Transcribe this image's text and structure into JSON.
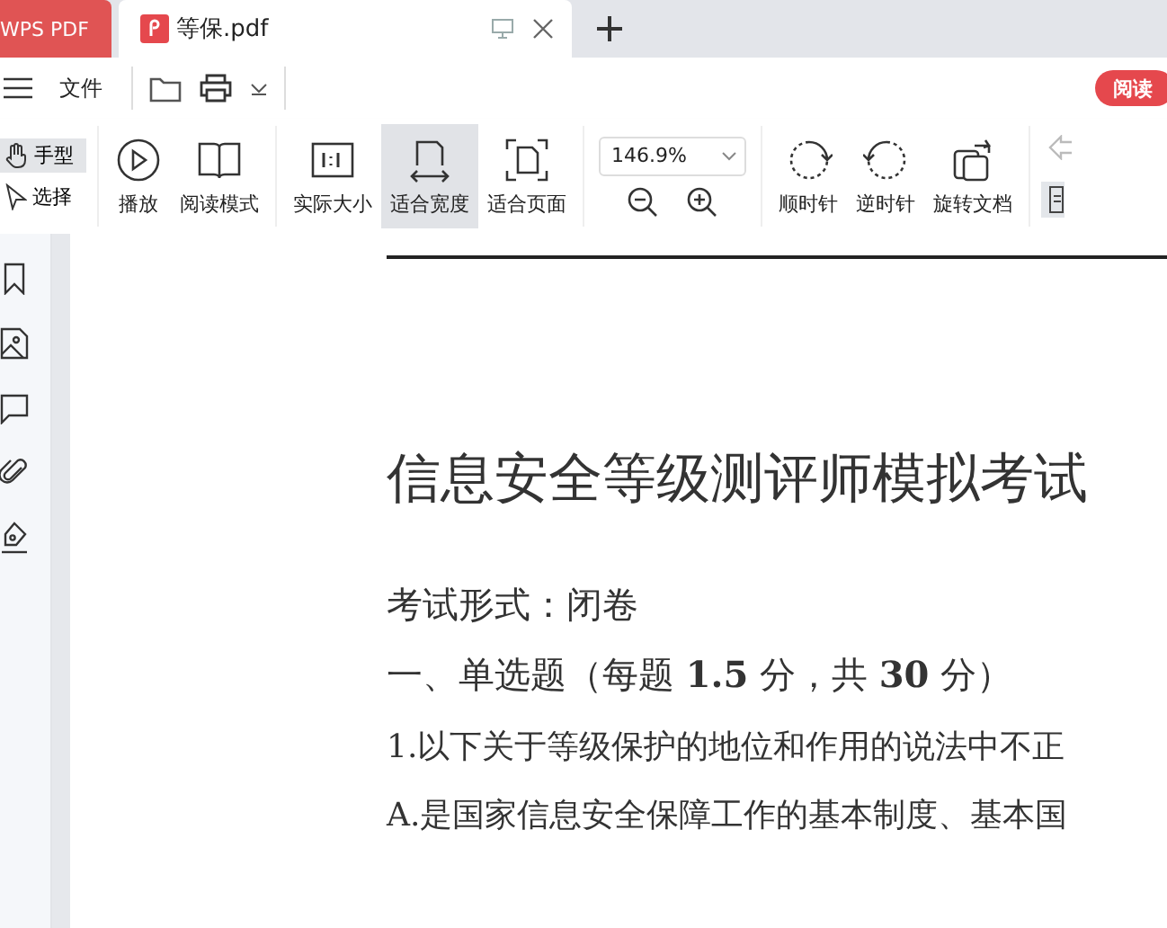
{
  "tabs": [
    {
      "label": "WPS PDF",
      "kind": "home",
      "selected": false
    },
    {
      "label": "等保.pdf",
      "kind": "doc",
      "selected": true
    }
  ],
  "menu_bar": {
    "file_menu": "文件",
    "read_button": "阅读"
  },
  "toolbar": {
    "tools": [
      {
        "kind": "stack",
        "items": [
          {
            "label": "手型",
            "selected": true
          },
          {
            "label": "选择",
            "selected": false
          }
        ]
      },
      {
        "kind": "sep"
      },
      {
        "kind": "large",
        "label": "播放",
        "selected": false
      },
      {
        "kind": "large",
        "label": "阅读模式",
        "selected": false
      },
      {
        "kind": "sep"
      },
      {
        "kind": "large",
        "label": "实际大小",
        "selected": false
      },
      {
        "kind": "large",
        "label": "适合宽度",
        "selected": true
      },
      {
        "kind": "large",
        "label": "适合页面",
        "selected": false
      },
      {
        "kind": "sep"
      },
      {
        "kind": "zoom",
        "value": "146.9%"
      },
      {
        "kind": "sep"
      },
      {
        "kind": "large",
        "label": "顺时针",
        "selected": false
      },
      {
        "kind": "large",
        "label": "逆时针",
        "selected": false
      },
      {
        "kind": "large",
        "label": "旋转文档",
        "selected": false
      },
      {
        "kind": "sep"
      },
      {
        "kind": "cut"
      }
    ]
  },
  "document": {
    "title": "信息安全等级测评师模拟考试",
    "lines": [
      {
        "kind": "heading",
        "text": "考试形式：闭卷"
      },
      {
        "kind": "heading",
        "text": "一、单选题（每题 **1.5** 分，共 **30** 分）"
      },
      {
        "kind": "body",
        "text": "1.以下关于等级保护的地位和作用的说法中不正"
      },
      {
        "kind": "body",
        "text": "A.是国家信息安全保障工作的基本制度、基本国"
      }
    ]
  }
}
